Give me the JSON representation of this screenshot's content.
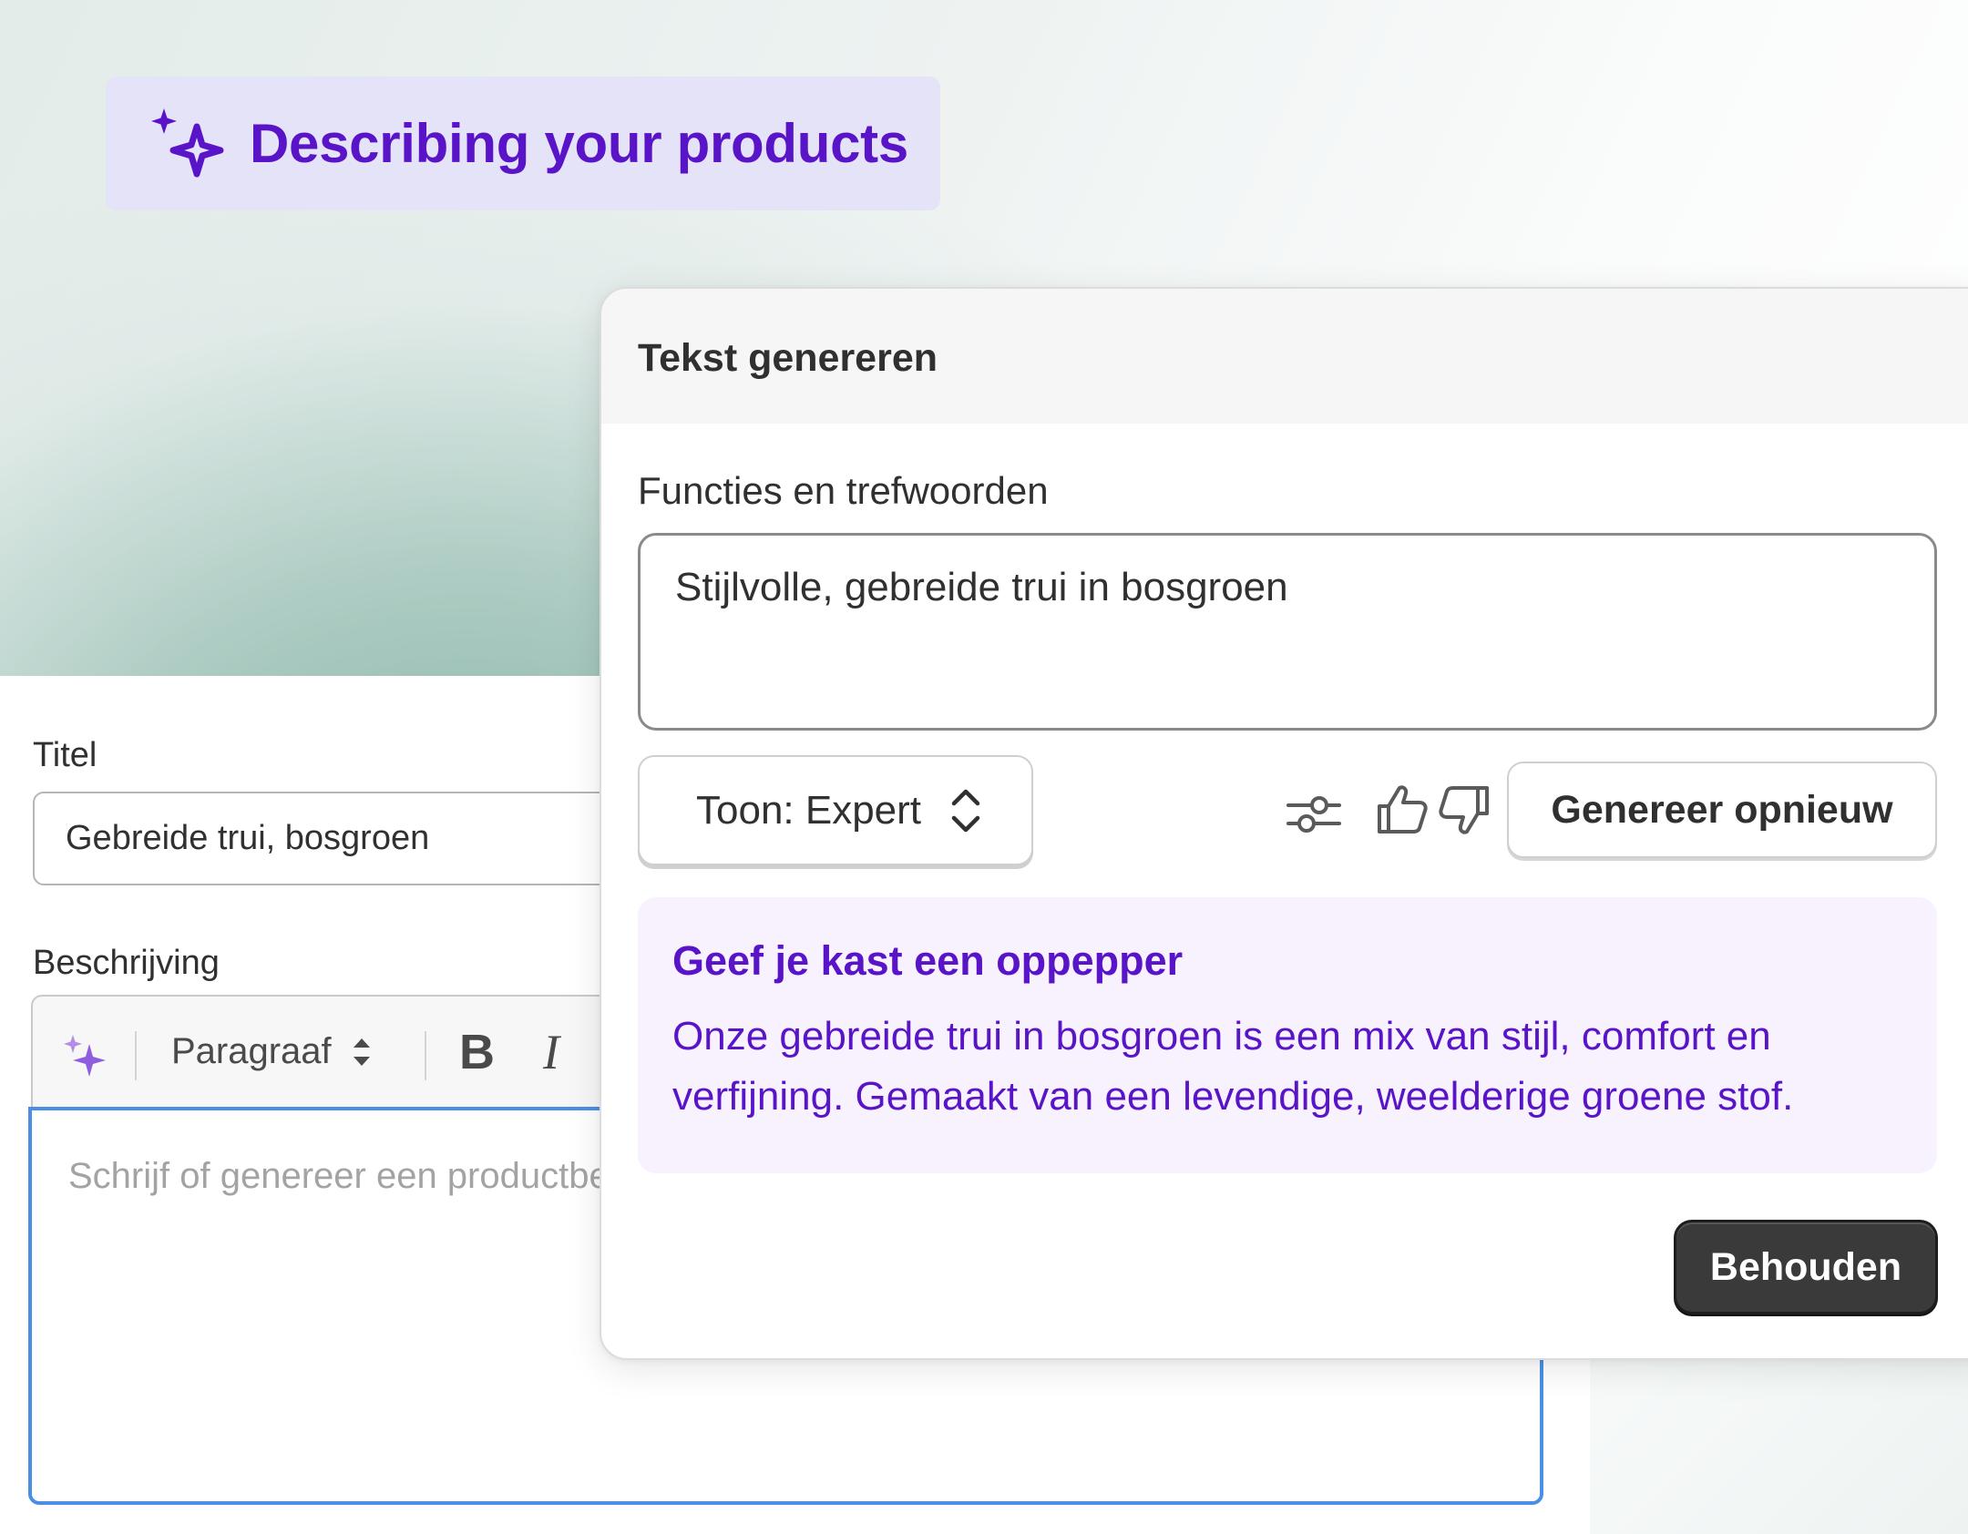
{
  "badge": {
    "text": "Describing your products",
    "icon": "sparkles-icon"
  },
  "product_form": {
    "title_label": "Titel",
    "title_value": "Gebreide trui, bosgroen",
    "description_label": "Beschrijving",
    "toolbar": {
      "ai_icon": "sparkles-icon",
      "format_select": "Paragraaf",
      "bold_label": "B",
      "italic_label": "I"
    },
    "description_placeholder": "Schrijf of genereer een productbeschrijving"
  },
  "generate_dialog": {
    "title": "Tekst genereren",
    "keywords_label": "Functies en trefwoorden",
    "keywords_value": "Stijlvolle, gebreide trui in bosgroen",
    "tone_select": "Toon: Expert",
    "icons": [
      "sliders-icon",
      "thumbs-up-icon",
      "thumbs-down-icon"
    ],
    "regenerate_button": "Genereer opnieuw",
    "result": {
      "title": "Geef je kast een oppepper",
      "body": "Onze gebreide trui in bosgroen is een mix van stijl, comfort en verfijning. Gemaakt van een levendige, weelderige groene stof."
    },
    "keep_button": "Behouden"
  },
  "colors": {
    "accent_purple": "#5a14c8",
    "badge_bg": "#e5e3f8",
    "result_bg": "#f7f2fd",
    "focus_blue": "#4a8fe6",
    "primary_button": "#3a3a3a"
  }
}
